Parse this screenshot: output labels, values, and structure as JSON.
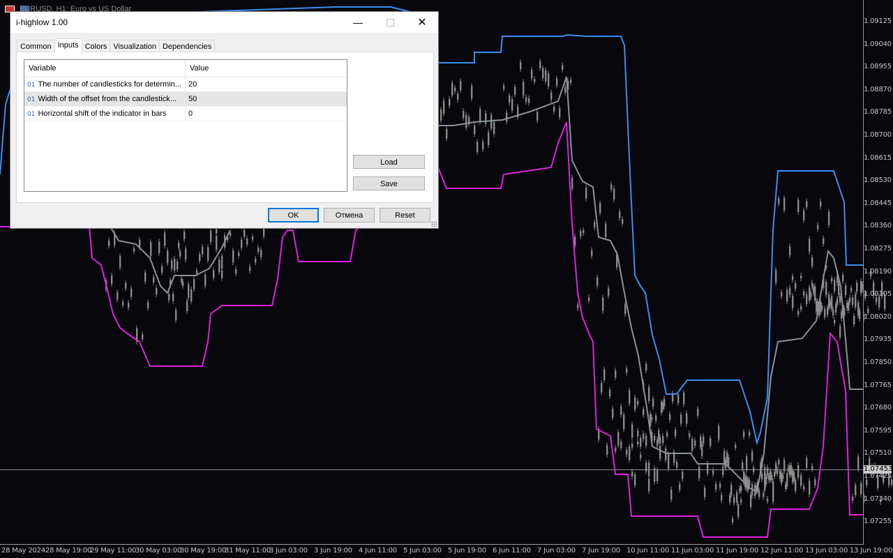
{
  "chart": {
    "title": "EURUSD, H1:  Euro vs US Dollar",
    "current_price": "1.07453",
    "price_labels": [
      "1.09125",
      "1.09040",
      "1.08955",
      "1.08870",
      "1.08785",
      "1.08700",
      "1.08615",
      "1.08530",
      "1.08445",
      "1.08360",
      "1.08275",
      "1.08190",
      "1.08105",
      "1.08020",
      "1.07935",
      "1.07850",
      "1.07765",
      "1.07680",
      "1.07595",
      "1.07510",
      "1.07425",
      "1.07340",
      "1.07255"
    ],
    "time_labels": [
      "28 May 2024",
      "28 May 19:00",
      "29 May 11:00",
      "30 May 03:00",
      "30 May 19:00",
      "31 May 11:00",
      "3 Jun 03:00",
      "3 Jun 19:00",
      "4 Jun 11:00",
      "5 Jun 03:00",
      "5 Jun 19:00",
      "6 Jun 11:00",
      "7 Jun 03:00",
      "7 Jun 19:00",
      "10 Jun 11:00",
      "11 Jun 03:00",
      "11 Jun 19:00",
      "12 Jun 11:00",
      "13 Jun 03:00",
      "13 Jun 19:00"
    ],
    "colors": {
      "upper": "#3a8ff0",
      "lower": "#e020e0",
      "middle": "#8a949c",
      "candles": "#8a8a8a"
    }
  },
  "dialog": {
    "title": "i-highlow 1.00",
    "tabs": [
      "Common",
      "Inputs",
      "Colors",
      "Visualization",
      "Dependencies"
    ],
    "active_tab": "Inputs",
    "grid": {
      "headers": {
        "variable": "Variable",
        "value": "Value"
      },
      "rows": [
        {
          "icon": "01",
          "variable": "The number of candlesticks for determin...",
          "value": "20"
        },
        {
          "icon": "01",
          "variable": "Width of the offset from the candlestick...",
          "value": "50"
        },
        {
          "icon": "01",
          "variable": "Horizontal shift of the indicator in bars",
          "value": "0"
        }
      ]
    },
    "buttons": {
      "load": "Load",
      "save": "Save",
      "ok": "OK",
      "cancel": "Отмена",
      "reset": "Reset"
    }
  }
}
